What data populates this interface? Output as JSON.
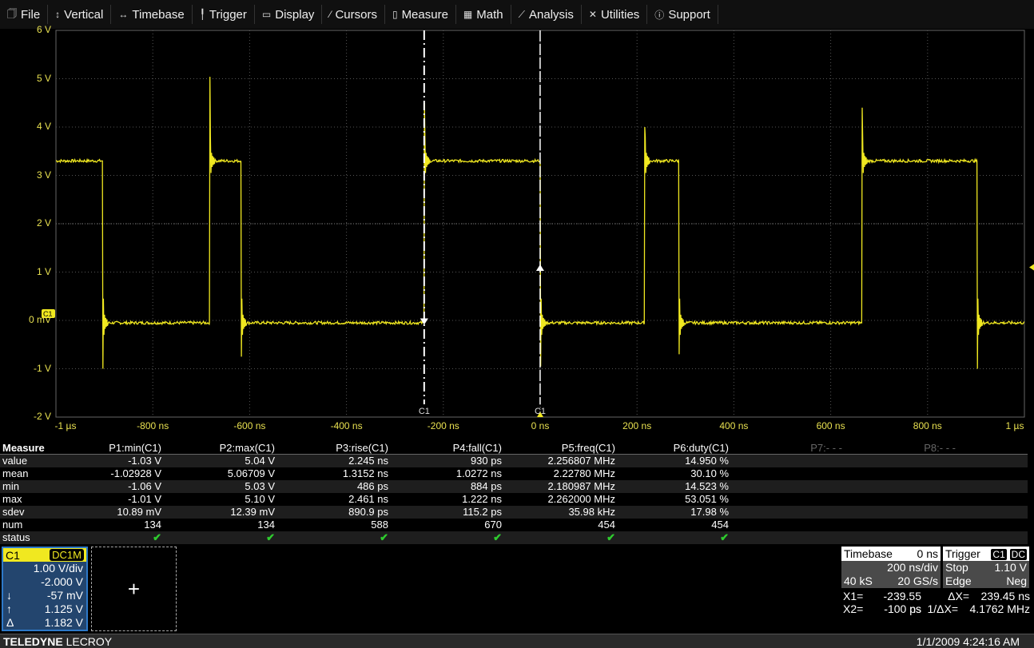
{
  "menu": [
    {
      "icon": "file-icon",
      "glyph": "🗍",
      "label": "File"
    },
    {
      "icon": "vertical-icon",
      "glyph": "↕",
      "label": "Vertical"
    },
    {
      "icon": "timebase-icon",
      "glyph": "↔",
      "label": "Timebase"
    },
    {
      "icon": "trigger-icon",
      "glyph": "╿",
      "label": "Trigger"
    },
    {
      "icon": "display-icon",
      "glyph": "▭",
      "label": "Display"
    },
    {
      "icon": "cursors-icon",
      "glyph": "⁄",
      "label": "Cursors"
    },
    {
      "icon": "measure-icon",
      "glyph": "▯",
      "label": "Measure"
    },
    {
      "icon": "math-icon",
      "glyph": "▦",
      "label": "Math"
    },
    {
      "icon": "analysis-icon",
      "glyph": "⟋",
      "label": "Analysis"
    },
    {
      "icon": "utilities-icon",
      "glyph": "✕",
      "label": "Utilities"
    },
    {
      "icon": "support-icon",
      "glyph": "ⓘ",
      "label": "Support"
    }
  ],
  "grid": {
    "y_labels": [
      "6 V",
      "5 V",
      "4 V",
      "3 V",
      "2 V",
      "1 V",
      "0 mV",
      "-1 V",
      "-2 V"
    ],
    "x_labels": [
      "-1 µs",
      "-800 ns",
      "-600 ns",
      "-400 ns",
      "-200 ns",
      "0 ns",
      "200 ns",
      "400 ns",
      "600 ns",
      "800 ns",
      "1 µs"
    ],
    "trace_label": "C1",
    "trace_color": "#f0e820",
    "trace_edges_ns": [
      [
        -904,
        "fall",
        -1.0
      ],
      [
        -683,
        "rise",
        5.04
      ],
      [
        -618,
        "fall",
        -0.75
      ],
      [
        -240,
        "rise",
        4.5
      ],
      [
        0,
        "fall",
        -0.95
      ],
      [
        215,
        "rise",
        4.0
      ],
      [
        286,
        "fall",
        -0.7
      ],
      [
        664,
        "rise",
        4.4
      ],
      [
        902,
        "fall",
        -1.0
      ]
    ],
    "trace_high_v": 3.3,
    "trace_low_v": -0.05,
    "trace_initial": "high"
  },
  "cursors": {
    "x1_label": "C1",
    "x2_label": "C1",
    "x1_ns": -239.55,
    "x2_ns": -0.1,
    "y_down_v": -0.057,
    "y_up_v": 1.125
  },
  "measure": {
    "title": "Measure",
    "columns": [
      "P1:min(C1)",
      "P2:max(C1)",
      "P3:rise(C1)",
      "P4:fall(C1)",
      "P5:freq(C1)",
      "P6:duty(C1)",
      "P7:- - -",
      "P8:- - -"
    ],
    "rows": [
      {
        "label": "value",
        "cells": [
          "-1.03 V",
          "5.04 V",
          "2.245 ns",
          "930 ps",
          "2.256807 MHz",
          "14.950 %",
          "",
          ""
        ]
      },
      {
        "label": "mean",
        "cells": [
          "-1.02928 V",
          "5.06709 V",
          "1.3152 ns",
          "1.0272 ns",
          "2.22780 MHz",
          "30.10 %",
          "",
          ""
        ]
      },
      {
        "label": "min",
        "cells": [
          "-1.06 V",
          "5.03 V",
          "486 ps",
          "884 ps",
          "2.180987 MHz",
          "14.523 %",
          "",
          ""
        ]
      },
      {
        "label": "max",
        "cells": [
          "-1.01 V",
          "5.10 V",
          "2.461 ns",
          "1.222 ns",
          "2.262000 MHz",
          "53.051 %",
          "",
          ""
        ]
      },
      {
        "label": "sdev",
        "cells": [
          "10.89 mV",
          "12.39 mV",
          "890.9 ps",
          "115.2 ps",
          "35.98 kHz",
          "17.98 %",
          "",
          ""
        ]
      },
      {
        "label": "num",
        "cells": [
          "134",
          "134",
          "588",
          "670",
          "454",
          "454",
          "",
          ""
        ]
      },
      {
        "label": "status",
        "cells": [
          "✔",
          "✔",
          "✔",
          "✔",
          "✔",
          "✔",
          "",
          ""
        ]
      }
    ]
  },
  "channel": {
    "name": "C1",
    "coupling": "DC1M",
    "vdiv": "1.00 V/div",
    "offset": "-2.000 V",
    "down_sym": "↓",
    "down": "-57 mV",
    "up_sym": "↑",
    "up": "1.125 V",
    "delta_sym": "Δ",
    "delta": "1.182 V"
  },
  "add_trace": "+",
  "timebase": {
    "title": "Timebase",
    "delay": "0 ns",
    "tdiv": "200 ns/div",
    "samples": "40 kS",
    "rate": "20 GS/s"
  },
  "trigger": {
    "title": "Trigger",
    "source": "C1",
    "coupling": "DC",
    "mode": "Stop",
    "level": "1.10 V",
    "type": "Edge",
    "slope": "Neg"
  },
  "readout": {
    "x1_k": "X1=",
    "x1": "-239.55 ns",
    "dx_k": "ΔX=",
    "dx": "239.45 ns",
    "x2_k": "X2=",
    "x2": "-100 ps",
    "inv_k": "1/ΔX=",
    "inv": "4.1762 MHz"
  },
  "status": {
    "brand_bold": "TELEDYNE",
    "brand": " LECROY",
    "datetime": "1/1/2009 4:24:16 AM"
  }
}
